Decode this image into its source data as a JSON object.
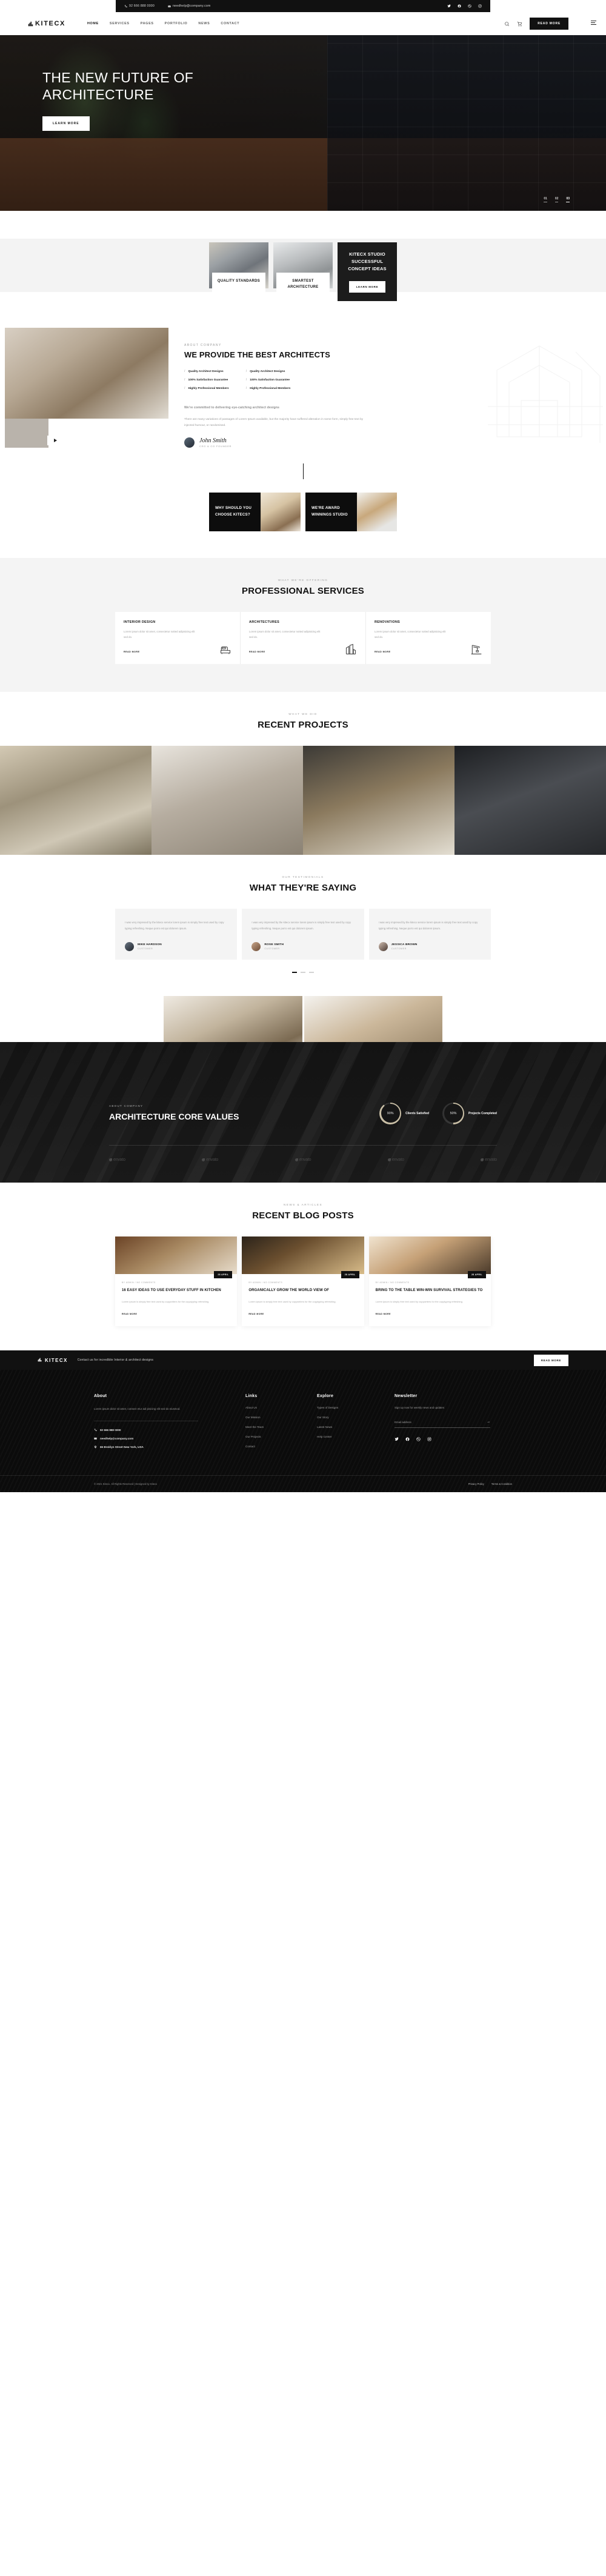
{
  "topbar": {
    "phone": "92 666 888 0000",
    "email": "needhelp@company.com",
    "socials": [
      "twitter-icon",
      "facebook-icon",
      "dribbble-icon",
      "instagram-icon"
    ]
  },
  "header": {
    "brand": "KITECX",
    "nav": [
      {
        "label": "HOME",
        "active": true
      },
      {
        "label": "SERVICES",
        "active": false
      },
      {
        "label": "PAGES",
        "active": false
      },
      {
        "label": "PORTFOLIO",
        "active": false
      },
      {
        "label": "NEWS",
        "active": false
      },
      {
        "label": "CONTACT",
        "active": false
      }
    ],
    "cta": "READ MORE"
  },
  "hero": {
    "title": "THE NEW FUTURE OF ARCHITECTURE",
    "button": "LEARN MORE",
    "slides": [
      "01",
      "02",
      "03"
    ]
  },
  "features": [
    {
      "title": "QUALITY STANDARDS"
    },
    {
      "title": "SMARTEST ARCHITECTURE"
    },
    {
      "title": "KITECX STUDIO SUCCESSFUL CONCEPT IDEAS",
      "button": "LEARN MORE"
    }
  ],
  "about": {
    "eyebrow": "ABOUT COMPANY",
    "title": "WE PROVIDE THE BEST ARCHITECTS",
    "list_left": [
      "Quality Architect Designs",
      "100% Satisfaction Guarantee",
      "Highly Professional Members"
    ],
    "list_right": [
      "Quality Architect Designs",
      "100% Satisfaction Guarantee",
      "Highly Professional Members"
    ],
    "lead": "We're committed to delivering eye-catching architect designs",
    "paragraph": "There are many variations of passages of Lorem Ipsum available, but the majority have suffered alteration in some form, simply free text by injected humour, or randomised.",
    "signature": "John Smith",
    "role": "CEO & CO FOUNDER"
  },
  "choose": [
    {
      "title": "WHY SHOULD YOU CHOOSE KITECS?"
    },
    {
      "title": "WE'RE AWARD WINNINGS STUDIO"
    }
  ],
  "services": {
    "eyebrow": "WHAT WE'RE OFFERING",
    "title": "PROFESSIONAL SERVICES",
    "items": [
      {
        "title": "INTERIOR DESIGN",
        "desc": "Lorem ipsum dolor sit amet, consectetur notted adipisicing elit sed do.",
        "more": "READ MORE",
        "icon": "sofa-icon"
      },
      {
        "title": "ARCHITECTURES",
        "desc": "Lorem ipsum dolor sit amet, consectetur notted adipisicing elit sed do.",
        "more": "READ MORE",
        "icon": "building-icon"
      },
      {
        "title": "RENOVATIONS",
        "desc": "Lorem ipsum dolor sit amet, consectetur notted adipisicing elit sed do.",
        "more": "READ MORE",
        "icon": "crane-icon"
      }
    ]
  },
  "projects": {
    "eyebrow": "WHAT WE DID",
    "title": "RECENT PROJECTS"
  },
  "testimonials": {
    "eyebrow": "OUR TESTIMONIALS",
    "title": "WHAT THEY'RE SAYING",
    "items": [
      {
        "quote": "I was very impresed by the kitecx service lorem ipsum is simply free text used by copy typing refreshing. Neque porro est qui dolorem ipsum.",
        "name": "MIKE HARDSON",
        "role": "CUSTOMER"
      },
      {
        "quote": "I was very impresed by the kitecx service lorem ipsum is simply free text used by copy typing refreshing. Neque porro est qui dolorem ipsum.",
        "name": "ROSE SMITH",
        "role": "CUSTOMER"
      },
      {
        "quote": "I was very impresed by the kitecx service lorem ipsum is simply free text used by copy typing refreshing. Neque porro est qui dolorem ipsum.",
        "name": "JESSICA BROWN",
        "role": "CUSTOMER"
      }
    ]
  },
  "core": {
    "eyebrow": "ABOUT COMPANY",
    "title": "ARCHITECTURE CORE VALUES",
    "stats": [
      {
        "value": "90%",
        "label": "Clients Satisfied",
        "percent": 90
      },
      {
        "value": "50%",
        "label": "Projects Completed",
        "percent": 50
      }
    ],
    "brands": [
      "envato",
      "envato",
      "envato",
      "envato",
      "envato"
    ]
  },
  "blog": {
    "eyebrow": "NEWS & ARTICLES",
    "title": "RECENT BLOG POSTS",
    "posts": [
      {
        "date": "28 APRIL",
        "meta": "BY ADMIN  /  NO COMMENTS",
        "title": "16 EASY IDEAS TO USE EVERYDAY STUFF IN KITCHEN",
        "desc": "Lorem ipsum is simply free text used by copywriters for the copytyping refreshing.",
        "more": "READ MORE"
      },
      {
        "date": "28 APRIL",
        "meta": "BY ADMIN  /  NO COMMENTS",
        "title": "ORGANICALLY GROW THE WORLD VIEW OF",
        "desc": "Lorem ipsum is simply free text used by copywriters for the copytyping refreshing.",
        "more": "READ MORE"
      },
      {
        "date": "28 APRIL",
        "meta": "BY ADMIN  /  NO COMMENTS",
        "title": "BRING TO THE TABLE WIN-WIN SURVIVAL STRATEGIES TO",
        "desc": "Lorem ipsum is simply free text used by copywriters for the copytyping refreshing.",
        "more": "READ MORE"
      }
    ]
  },
  "cta": {
    "brand": "KITECX",
    "text": "Contact us for incredible Interior & architect designs",
    "button": "READ MORE"
  },
  "footer": {
    "about": {
      "heading": "About",
      "text": "Lorem ipsum dolor sit amet, consect etur adi pisicing elit sed do eiusmod.",
      "phone": "92 666 888 0000",
      "email": "needhelp@company.com",
      "address": "66 Broklyn Street New York, USA"
    },
    "links": {
      "heading": "Links",
      "items": [
        "About Us",
        "Our Mission",
        "Meet the Team",
        "Our Projects",
        "Contact"
      ]
    },
    "explore": {
      "heading": "Explore",
      "items": [
        "Types of Designs",
        "Our Story",
        "Latest News",
        "Help Center"
      ]
    },
    "newsletter": {
      "heading": "Newsletter",
      "subtitle": "Sign up now for weekly news and updates",
      "placeholder": "Email address",
      "socials": [
        "twitter-icon",
        "facebook-icon",
        "dribbble-icon",
        "instagram-icon"
      ]
    },
    "copyright": "© 2021 Kitecx. All Rights Reserved | Designed by Kitecx",
    "legal": [
      "Privacy Policy",
      "Terms & Condition"
    ]
  }
}
